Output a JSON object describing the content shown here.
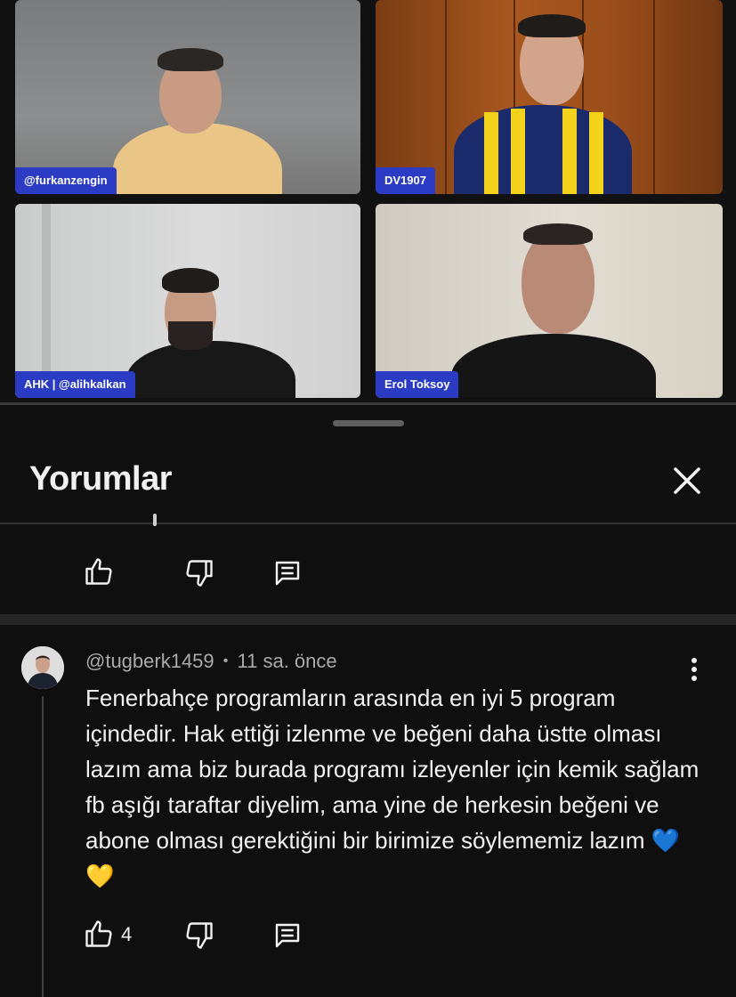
{
  "video": {
    "tiles": [
      {
        "label": "@furkanzengin"
      },
      {
        "label": "DV1907"
      },
      {
        "label": "AHK | @alihkalkan"
      },
      {
        "label": "Erol Toksoy"
      }
    ]
  },
  "comments_panel": {
    "title": "Yorumlar"
  },
  "comment": {
    "author": "@tugberk1459",
    "separator": "•",
    "time": "11 sa. önce",
    "text": "Fenerbahçe programların arasında en iyi 5 program içindedir. Hak ettiği izlenme ve beğeni daha üstte olması lazım ama biz burada programı izleyenler için kemik sağlam fb aşığı taraftar diyelim, ama yine de herkesin beğeni ve abone olması gerektiğini bir birimize söylememiz lazım 💙💛",
    "like_count": "4"
  },
  "colors": {
    "background": "#0f0f0f",
    "nametag": "#2b3bc4",
    "secondary_text": "#aaaaaa"
  },
  "icons": [
    "close-icon",
    "thumbs-up-icon",
    "thumbs-down-icon",
    "reply-icon",
    "more-vert-icon"
  ]
}
